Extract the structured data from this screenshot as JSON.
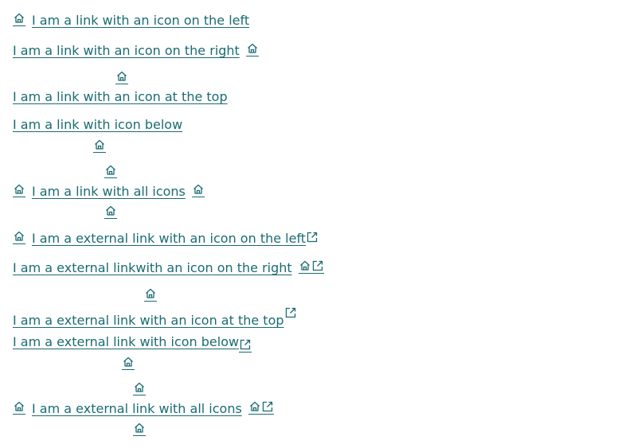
{
  "links": {
    "left": "I am a link with an icon on the left",
    "right": "I am a link with an icon on the right",
    "top": "I am a link with an icon at the top",
    "below": "I am a link with icon below",
    "all": "I am a link with all icons",
    "ext_left": "I am a external link with an icon on the left",
    "ext_right": "I am a external linkwith an icon on the right",
    "ext_top": "I am a external link with an icon at the top",
    "ext_below": "I am a external link with icon below",
    "ext_all": "I am a external link with all icons"
  },
  "colors": {
    "link": "#1b6b73",
    "background": "#ffffff"
  },
  "icons": {
    "home": "home-icon",
    "external": "external-link-icon"
  }
}
